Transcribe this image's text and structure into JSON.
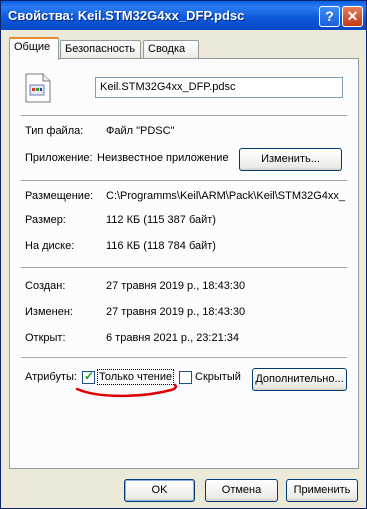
{
  "window": {
    "title": "Свойства: Keil.STM32G4xx_DFP.pdsc",
    "help_glyph": "?",
    "close_glyph": "✕"
  },
  "tabs": [
    "Общие",
    "Безопасность",
    "Сводка"
  ],
  "file_name": "Keil.STM32G4xx_DFP.pdsc",
  "file_icon": "generic-file-icon",
  "rows": {
    "type_label": "Тип файла:",
    "type_value": "Файл \"PDSC\"",
    "app_label": "Приложение:",
    "app_value": "Неизвестное приложение",
    "change_button": "Изменить...",
    "location_label": "Размещение:",
    "location_value": "C:\\Programms\\Keil\\ARM\\Pack\\Keil\\STM32G4xx_",
    "size_label": "Размер:",
    "size_value": "112 КБ (115 387 байт)",
    "disk_label": "На диске:",
    "disk_value": "116 КБ (118 784 байт)",
    "created_label": "Создан:",
    "created_value": "27 травня 2019 р., 18:43:30",
    "modified_label": "Изменен:",
    "modified_value": "27 травня 2019 р., 18:43:30",
    "opened_label": "Открыт:",
    "opened_value": "6 травня 2021 р., 23:21:34"
  },
  "attributes": {
    "label": "Атрибуты:",
    "readonly_label": "Только чтение",
    "readonly_checked": true,
    "hidden_label": "Скрытый",
    "hidden_checked": false,
    "advanced_button": "Дополнительно..."
  },
  "buttons": {
    "ok": "OK",
    "cancel": "Отмена",
    "apply": "Применить"
  },
  "colors": {
    "titlebar": "#0b58d9",
    "tab_highlight": "#e68b2c",
    "annotation_underline": "#e00000"
  }
}
